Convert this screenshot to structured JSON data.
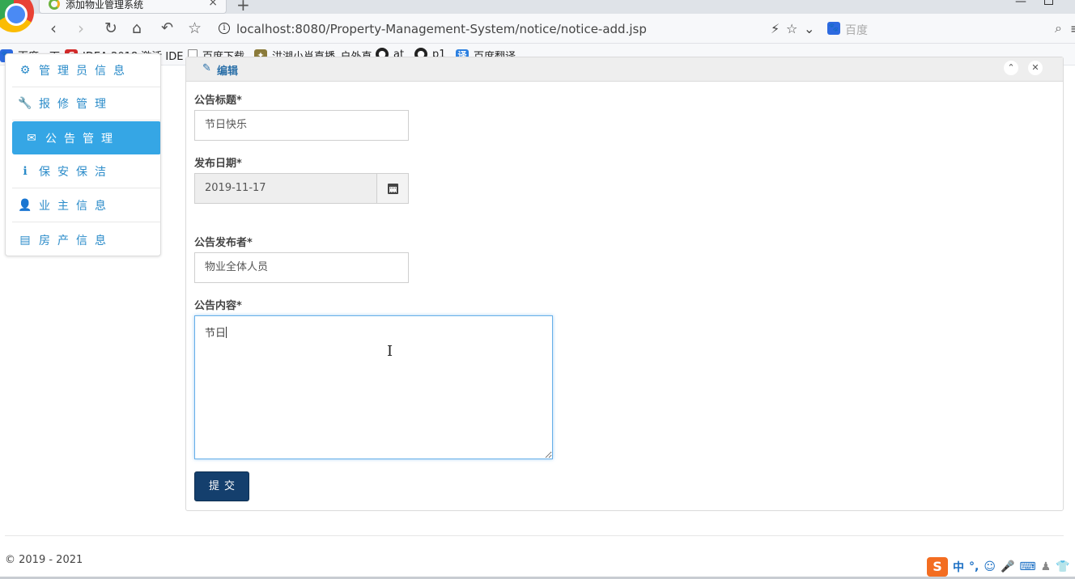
{
  "browser": {
    "tab_title": "添加物业管理系统",
    "tab_close": "×",
    "new_tab": "+",
    "url": "localhost:8080/Property-Management-System/notice/notice-add.jsp",
    "search_placeholder": "百度",
    "bookmarks": [
      {
        "label": "百度一下",
        "icon": "baidu-paw-icon",
        "color": "#2d6ae0"
      },
      {
        "label": "IDEA 2018 激活 IDE",
        "icon": "c-logo-icon",
        "color": "#d22a2a"
      },
      {
        "label": "百度下载",
        "icon": "page-icon",
        "color": "#888888"
      },
      {
        "label": "洪湖小肖直播_户外直",
        "icon": "site-icon",
        "color": "#8a7a3a"
      },
      {
        "label": "at",
        "icon": "github-icon",
        "color": "#222222"
      },
      {
        "label": "p1",
        "icon": "github-icon",
        "color": "#222222"
      },
      {
        "label": "百度翻译",
        "icon": "translate-icon",
        "color": "#2b7fe0"
      }
    ]
  },
  "sidebar": {
    "items": [
      {
        "label": "管理员信息",
        "icon": "gear-icon",
        "glyph": "⚙"
      },
      {
        "label": "报修管理",
        "icon": "wrench-icon",
        "glyph": "🔧"
      },
      {
        "label": "公告管理",
        "icon": "envelope-icon",
        "glyph": "✉",
        "active": true
      },
      {
        "label": "保安保洁",
        "icon": "info-circle-icon",
        "glyph": "ℹ"
      },
      {
        "label": "业主信息",
        "icon": "user-icon",
        "glyph": "👤"
      },
      {
        "label": "房产信息",
        "icon": "list-icon",
        "glyph": "▤"
      }
    ],
    "active_color": "#35a6e5"
  },
  "panel": {
    "title": "编辑",
    "collapse": "⌃",
    "close": "✕"
  },
  "form": {
    "title_label": "公告标题*",
    "title_value": "节日快乐",
    "date_label": "发布日期*",
    "date_value": "2019-11-17",
    "publisher_label": "公告发布者*",
    "publisher_value": "物业全体人员",
    "content_label": "公告内容*",
    "content_value": "节日",
    "submit_label": "提交",
    "submit_color": "#143f6d"
  },
  "footer": {
    "copyright": "© 2019 - 2021"
  },
  "ime": {
    "logo": "S",
    "lang": "中"
  }
}
